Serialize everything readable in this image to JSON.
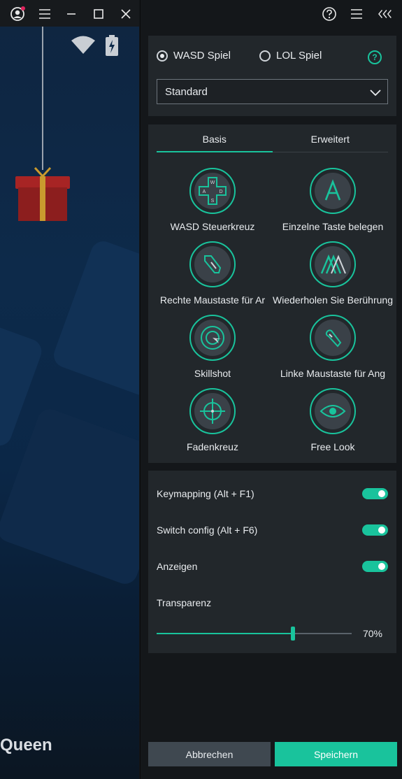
{
  "game": {
    "overlay_text": "Queen"
  },
  "title_bar": {
    "icons": [
      "account-icon",
      "menu-icon",
      "minimize-icon",
      "maximize-icon",
      "close-icon"
    ]
  },
  "panel_header": {
    "icons": [
      "help-icon",
      "menu-icon",
      "collapse-icon"
    ]
  },
  "mode": {
    "options": [
      "WASD Spiel",
      "LOL Spiel"
    ],
    "selected": "WASD Spiel",
    "preset_value": "Standard"
  },
  "tabs": {
    "items": [
      "Basis",
      "Erweitert"
    ],
    "active": "Basis"
  },
  "tools": [
    {
      "label": "WASD Steuerkreuz",
      "icon": "dpad-icon"
    },
    {
      "label": "Einzelne Taste belegen",
      "icon": "single-key-icon"
    },
    {
      "label": "Rechte Maustaste für Ar",
      "icon": "right-mouse-icon"
    },
    {
      "label": "Wiederholen Sie Berührung",
      "icon": "repeat-tap-icon"
    },
    {
      "label": "Skillshot",
      "icon": "skillshot-icon"
    },
    {
      "label": "Linke Maustaste für Ang",
      "icon": "left-mouse-icon"
    },
    {
      "label": "Fadenkreuz",
      "icon": "crosshair-icon"
    },
    {
      "label": "Free Look",
      "icon": "eye-icon"
    }
  ],
  "settings": {
    "keymapping": {
      "label": "Keymapping (Alt + F1)",
      "on": true
    },
    "switch_config": {
      "label": "Switch config (Alt + F6)",
      "on": true
    },
    "show": {
      "label": "Anzeigen",
      "on": true
    },
    "transparency_label": "Transparenz",
    "transparency_value": "70%",
    "transparency_fraction": 0.7
  },
  "buttons": {
    "cancel": "Abbrechen",
    "save": "Speichern"
  },
  "colors": {
    "accent": "#19c39c",
    "panel_bg": "#14171a",
    "card_bg": "#22272b",
    "notification_dot": "#e0245e"
  }
}
